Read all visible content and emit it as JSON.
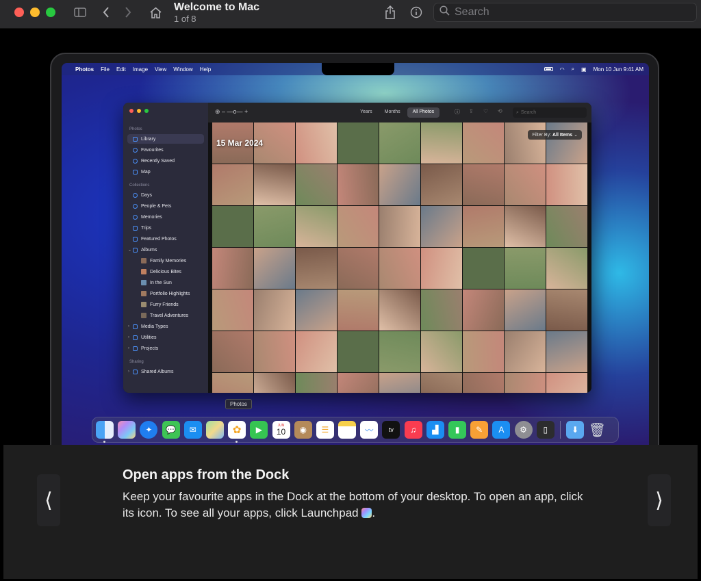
{
  "window": {
    "title": "Welcome to Mac",
    "subtitle": "1 of 8",
    "search_placeholder": "Search",
    "icons": [
      "sidebar-icon",
      "chevron-left-icon",
      "chevron-right-icon",
      "home-icon",
      "share-icon",
      "info-icon",
      "search-icon"
    ]
  },
  "mac": {
    "menubar": {
      "app": "Photos",
      "items": [
        "File",
        "Edit",
        "Image",
        "View",
        "Window",
        "Help"
      ],
      "clock": "Mon 10 Jun  9:41 AM"
    },
    "photos": {
      "sidebar": {
        "section_photos": "Photos",
        "library": "Library",
        "favourites": "Favourites",
        "recently_saved": "Recently Saved",
        "map": "Map",
        "section_collections": "Collections",
        "days": "Days",
        "people_pets": "People & Pets",
        "memories": "Memories",
        "trips": "Trips",
        "featured": "Featured Photos",
        "albums": "Albums",
        "album_items": [
          "Family Memories",
          "Delicious Bites",
          "In the Sun",
          "Portfolio Highlights",
          "Furry Friends",
          "Travel Adventures"
        ],
        "media_types": "Media Types",
        "utilities": "Utilities",
        "projects": "Projects",
        "section_sharing": "Sharing",
        "shared_albums": "Shared Albums"
      },
      "toolbar": {
        "years": "Years",
        "months": "Months",
        "all_photos": "All Photos",
        "search_placeholder": "Search"
      },
      "date_label": "15 Mar 2024",
      "filter_label": "Filter By:",
      "filter_value": "All Items"
    },
    "tooltip": "Photos",
    "dock": {
      "calendar_month": "JUN",
      "calendar_day": "10",
      "tv_label": "tv"
    }
  },
  "caption": {
    "title": "Open apps from the Dock",
    "body": "Keep your favourite apps in the Dock at the bottom of your desktop. To open an app, click its icon. To see all your apps, click Launchpad",
    "body_end": "."
  },
  "nav": {
    "prev": "⟨",
    "next": "⟩"
  }
}
